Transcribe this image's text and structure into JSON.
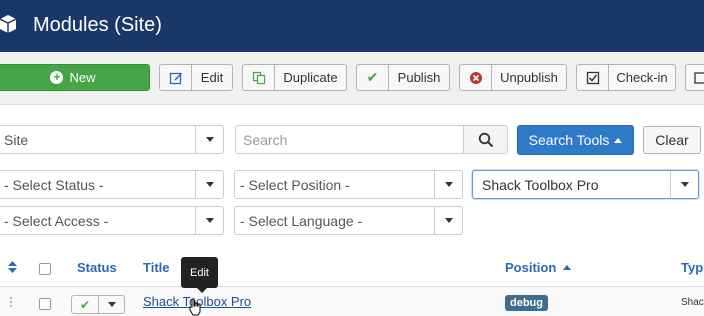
{
  "header": {
    "title": "Modules (Site)",
    "icon": "cube-icon"
  },
  "toolbar": {
    "buttons": [
      {
        "label": "New",
        "icon": "plus-circle-icon"
      },
      {
        "label": "Edit",
        "icon": "edit-icon"
      },
      {
        "label": "Duplicate",
        "icon": "copy-icon"
      },
      {
        "label": "Publish",
        "icon": "check-icon"
      },
      {
        "label": "Unpublish",
        "icon": "times-circle-icon"
      },
      {
        "label": "Check-in",
        "icon": "checkbox-icon"
      }
    ]
  },
  "filters": {
    "client": "Site",
    "search_placeholder": "Search",
    "search_tools_label": "Search Tools",
    "clear_label": "Clear",
    "status": "- Select Status -",
    "position": "- Select Position -",
    "module_type": "Shack Toolbox Pro",
    "access": "- Select Access -",
    "language": "- Select Language -"
  },
  "table": {
    "columns": {
      "status": "Status",
      "title": "Title",
      "position": "Position",
      "type": "Typ"
    },
    "rows": [
      {
        "title": "Shack Toolbox Pro",
        "position": "debug",
        "type": "Shac"
      }
    ]
  },
  "tooltip": {
    "text": "Edit"
  },
  "colors": {
    "header_bg": "#1a3867",
    "new_button": "#46a546",
    "search_tools": "#2f7ac8",
    "link": "#1f4e8c"
  }
}
